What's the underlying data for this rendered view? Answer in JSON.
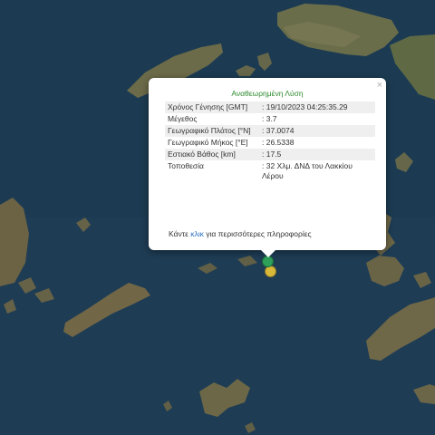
{
  "popup": {
    "title": "Αναθεωρημένη Λύση",
    "close_symbol": "×",
    "rows": [
      {
        "label": "Χρόνος Γένησης [GMT]",
        "value": ": 19/10/2023 04:25:35.29"
      },
      {
        "label": "Μέγεθος",
        "value": ": 3.7"
      },
      {
        "label": "Γεωγραφικό Πλάτος [°N]",
        "value": ": 37.0074"
      },
      {
        "label": "Γεωγραφικό Μήκος [°E]",
        "value": ": 26.5338"
      },
      {
        "label": "Εστιακό Βάθος [km]",
        "value": ": 17.5"
      },
      {
        "label": "Τοποθεσία",
        "value": ": 32 Χλμ. ΔΝΔ του Λακκίου Λέρου"
      }
    ],
    "more_prefix": "Κάντε ",
    "more_link": "κλικ",
    "more_suffix": " για περισσότερες πληροφορίες"
  },
  "markers": {
    "green": {
      "icon": "epicenter-marker",
      "color": "#2ea05a"
    },
    "yellow": {
      "icon": "earthquake-marker",
      "color": "#d8b93a"
    }
  }
}
